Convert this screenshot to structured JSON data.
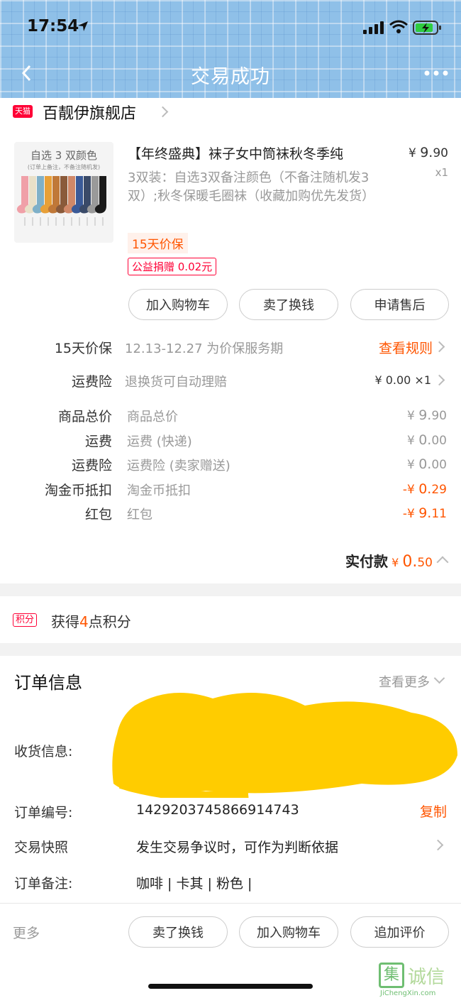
{
  "status_bar": {
    "time": "17:54"
  },
  "header": {
    "title": "交易成功"
  },
  "shop": {
    "badge": "天猫",
    "name": "百靓伊旗舰店"
  },
  "product": {
    "thumb_caption": "自选 3 双颜色",
    "thumb_sub": "(订单上备注，不备注随机发)",
    "sock_colors": [
      "#f0a0a8",
      "#e8e0c8",
      "#7fb0c8",
      "#e8a038",
      "#c07838",
      "#8a5a3a",
      "#d08868",
      "#3a5a98",
      "#3a4a68",
      "#9a9a9a",
      "#1a1a1a"
    ],
    "title": "【年终盛典】袜子女中筒袜秋冬季纯",
    "price_symbol": "¥",
    "price_int": "9.",
    "price_dec": "90",
    "quantity": "x1",
    "sku": "3双装：自选3双备注颜色（不备注随机发3双）;秋冬保暖毛圈袜（收藏加购优先发货）",
    "tag_price_protect": "15天价保",
    "tag_charity": "公益捐赠 0.02元",
    "buttons": [
      "加入购物车",
      "卖了换钱",
      "申请售后"
    ]
  },
  "services": [
    {
      "label": "15天价保",
      "desc": "12.13-12.27 为价保服务期",
      "action": "查看规则"
    },
    {
      "label": "运费险",
      "desc": "退换货可自动理赔",
      "amount": "¥ 0.00 ×1"
    }
  ],
  "price_rows": [
    {
      "label": "商品总价",
      "desc": "商品总价",
      "symbol": "¥",
      "int": "9.",
      "dec": "90",
      "highlight": false
    },
    {
      "label": "运费",
      "desc": "运费 (快递)",
      "symbol": "¥",
      "int": "0.",
      "dec": "00",
      "highlight": false
    },
    {
      "label": "运费险",
      "desc": "运费险 (卖家赠送)",
      "symbol": "¥",
      "int": "0.",
      "dec": "00",
      "highlight": false
    },
    {
      "label": "淘金币抵扣",
      "desc": "淘金币抵扣",
      "symbol": "-¥",
      "int": "0.",
      "dec": "29",
      "highlight": true
    },
    {
      "label": "红包",
      "desc": "红包",
      "symbol": "-¥",
      "int": "9.",
      "dec": "11",
      "highlight": true
    }
  ],
  "total": {
    "label": "实付款",
    "symbol": "¥",
    "int": "0.",
    "dec": "50"
  },
  "points": {
    "badge": "积分",
    "prefix": "获得",
    "count": "4",
    "suffix": "点积分"
  },
  "order_info": {
    "title": "订单信息",
    "more": "查看更多",
    "address_label": "收货信息:",
    "order_no_label": "订单编号:",
    "order_no": "1429203745866914743",
    "copy": "复制",
    "snapshot_label": "交易快照",
    "snapshot_desc": "发生交易争议时，可作为判断依据",
    "remark_label": "订单备注:",
    "remark": "咖啡 | 卡其 | 粉色 |"
  },
  "bottom_bar": {
    "more": "更多",
    "buttons": [
      "卖了换钱",
      "加入购物车",
      "追加评价"
    ]
  },
  "watermark": {
    "cn": "集诚信",
    "en": "JiChengXin.com"
  },
  "colors": {
    "accent": "#ff5500",
    "header_bg": "#8fc0e8",
    "tmall_red": "#ff0036",
    "redaction": "#ffcc00"
  }
}
